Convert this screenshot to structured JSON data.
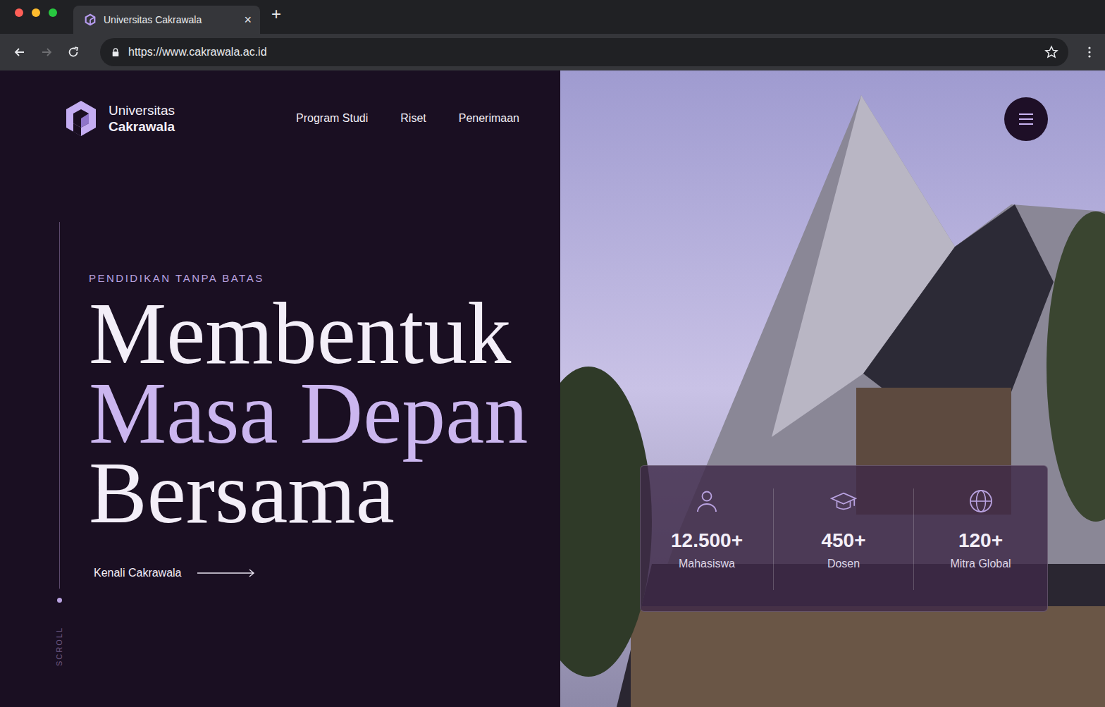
{
  "browser": {
    "tab_title": "Universitas Cakrawala",
    "tab_close": "×",
    "new_tab": "+",
    "url": "https://www.cakrawala.ac.id",
    "back_enabled": true,
    "forward_enabled": false
  },
  "logo": {
    "line1": "Universitas",
    "line2": "Cakrawala"
  },
  "nav": [
    {
      "label": "Program Studi"
    },
    {
      "label": "Riset"
    },
    {
      "label": "Penerimaan"
    }
  ],
  "hero": {
    "eyebrow": "PENDIDIKAN TANPA BATAS",
    "lines": [
      {
        "text": "Membentuk",
        "accent": false
      },
      {
        "text": "Masa Depan",
        "accent": true
      },
      {
        "text": "Bersama",
        "accent": false
      }
    ],
    "cta": "Kenali Cakrawala"
  },
  "scroll": "SCROLL",
  "stats": [
    {
      "value": "12.500+",
      "label": "Mahasiswa"
    },
    {
      "value": "450+",
      "label": "Dosen"
    },
    {
      "value": "120+",
      "label": "Mitra Global"
    }
  ]
}
